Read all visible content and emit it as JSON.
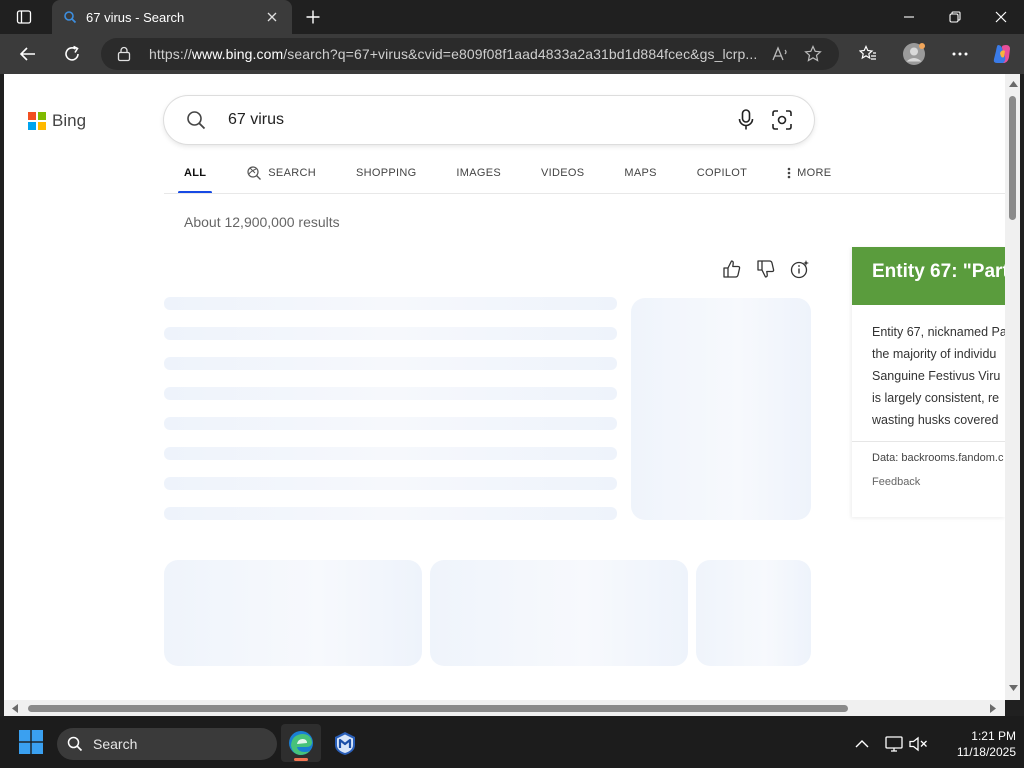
{
  "browser": {
    "tab": {
      "title": "67 virus - Search"
    },
    "address": {
      "url_prefix": "https://",
      "url_host": "www.bing.com",
      "url_rest": "/search?q=67+virus&cvid=e809f08f1aad4833a2a31bd1d884fcec&gs_lcrp..."
    }
  },
  "page": {
    "logo_text": "Bing",
    "search_query": "67 virus",
    "nav_tabs": [
      {
        "label": "ALL",
        "active": true
      },
      {
        "label": "SEARCH",
        "icon": "search-sparkle-icon"
      },
      {
        "label": "SHOPPING"
      },
      {
        "label": "IMAGES"
      },
      {
        "label": "VIDEOS"
      },
      {
        "label": "MAPS"
      },
      {
        "label": "COPILOT"
      },
      {
        "label": "MORE",
        "icon": "more-vertical-icon"
      }
    ],
    "results_count": "About 12,900,000 results",
    "entity_panel": {
      "title": "Entity 67: \"Part",
      "header_color": "#5a9c3d",
      "description_lines": [
        "Entity 67, nicknamed Pa",
        "the majority of individu",
        "Sanguine Festivus Viru",
        "is largely consistent, re",
        "wasting husks covered"
      ],
      "source": "Data: backrooms.fandom.c",
      "feedback": "Feedback"
    }
  },
  "taskbar": {
    "search_label": "Search",
    "time": "1:21 PM",
    "date": "11/18/2025"
  },
  "colors": {
    "accent": "#174ae4",
    "edge_indicator": "#f27452"
  }
}
